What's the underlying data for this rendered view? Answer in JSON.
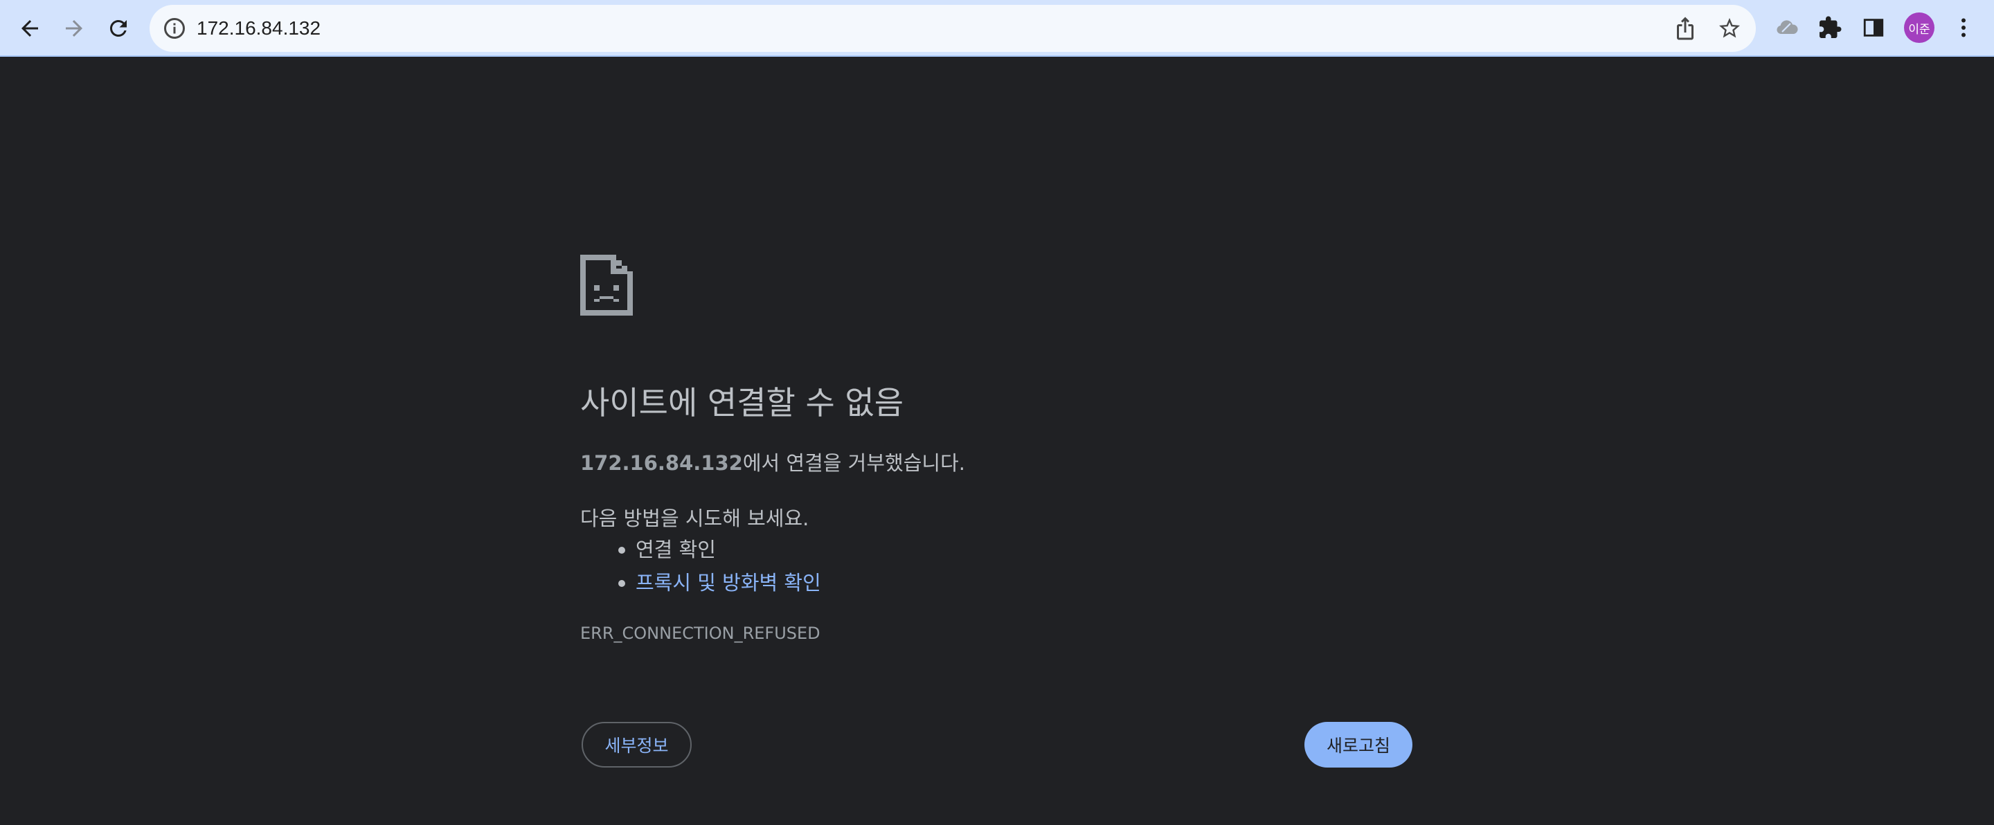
{
  "browser": {
    "url": "172.16.84.132",
    "profile_initials": "이준",
    "icons": {
      "back": "arrow-back-icon",
      "forward": "arrow-forward-icon",
      "reload": "reload-icon",
      "site_info": "info-icon",
      "share": "share-icon",
      "bookmark": "star-icon",
      "extension": "extension-cloud-icon",
      "extensions_menu": "puzzle-icon",
      "side_panel": "side-panel-icon",
      "menu": "kebab-menu-icon"
    },
    "colors": {
      "toolbar": "#d3e3fd",
      "omnibox": "#f4f8fd",
      "avatar": "#a33fbf"
    }
  },
  "error_page": {
    "icon": "sad-document-icon",
    "title": "사이트에 연결할 수 없음",
    "summary_host": "172.16.84.132",
    "summary_text": "에서 연결을 거부했습니다.",
    "suggestions_intro": "다음 방법을 시도해 보세요.",
    "suggestions": [
      {
        "label": "연결 확인",
        "is_link": false
      },
      {
        "label": "프록시 및 방화벽 확인",
        "is_link": true
      }
    ],
    "error_code": "ERR_CONNECTION_REFUSED",
    "details_button": "세부정보",
    "reload_button": "새로고침",
    "colors": {
      "background": "#202124",
      "text": "#bdc1c6",
      "link": "#8ab4f8",
      "primary_button": "#8ab4f8"
    }
  }
}
